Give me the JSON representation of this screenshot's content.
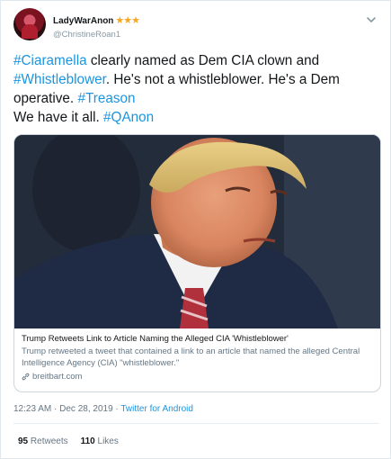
{
  "user": {
    "display_name": "LadyWarAnon",
    "badges": "★★★",
    "handle": "@ChristineRoan1"
  },
  "tweet": {
    "segments": [
      {
        "text": "#Ciaramella",
        "type": "hashtag"
      },
      {
        "text": " clearly named as Dem CIA clown and ",
        "type": "text"
      },
      {
        "text": "#Whistleblower",
        "type": "hashtag"
      },
      {
        "text": ". He's not a whistleblower. He's a Dem operative. ",
        "type": "text"
      },
      {
        "text": "#Treason",
        "type": "hashtag"
      },
      {
        "text": "We have it all. ",
        "type": "text"
      },
      {
        "text": "#QAnon",
        "type": "hashtag"
      }
    ]
  },
  "card": {
    "title": "Trump Retweets Link to Article Naming the Alleged CIA 'Whistleblower'",
    "description": "Trump retweeted a tweet that contained a link to an article that named the alleged Central Intelligence Agency (CIA) \"whistleblower.\"",
    "domain": "breitbart.com"
  },
  "meta": {
    "time_date": "12:23 AM · Dec 28, 2019",
    "separator": " · ",
    "client": "Twitter for Android"
  },
  "stats": {
    "retweets_count": "95",
    "retweets_label": "Retweets",
    "likes_count": "110",
    "likes_label": "Likes"
  },
  "colors": {
    "hashtag": "#1b95e0",
    "secondary_text": "#657786",
    "badge": "#f5a623"
  }
}
